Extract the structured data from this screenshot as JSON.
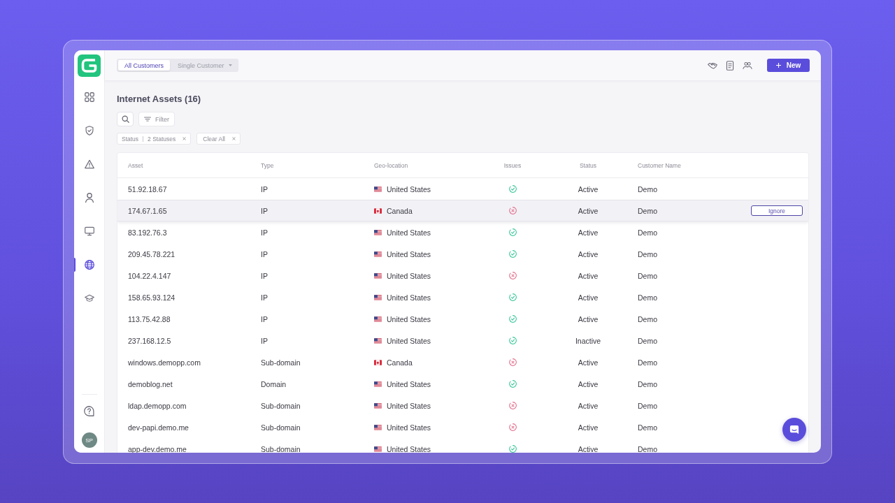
{
  "sidebar": {
    "items": [
      {
        "selected": false
      },
      {
        "selected": false
      },
      {
        "selected": false
      },
      {
        "selected": false
      },
      {
        "selected": false
      },
      {
        "selected": true
      },
      {
        "selected": false
      }
    ],
    "avatar": {
      "initials": "SP"
    }
  },
  "top_bar": {
    "scope_tabs": [
      {
        "label": "All Customers",
        "selected": true,
        "dropdown": false
      },
      {
        "label": "Single Customer",
        "selected": false,
        "dropdown": true
      }
    ],
    "new_button": {
      "label": "New"
    }
  },
  "page": {
    "title": "Internet Assets (16)",
    "filter_button": {
      "label": "Filter"
    },
    "chips": [
      {
        "kind": "filter",
        "label": "Status",
        "value": "2 Statuses"
      },
      {
        "kind": "clear",
        "label": "Clear All"
      }
    ]
  },
  "table": {
    "columns": [
      "Asset",
      "Type",
      "Geo-location",
      "Issues",
      "Status",
      "Customer Name"
    ],
    "rows": [
      {
        "asset": "51.92.18.67",
        "type": "IP",
        "geo": {
          "kind": "us",
          "country": "United States"
        },
        "issues_found": false,
        "status": "Active",
        "customer": "Demo",
        "highlighted": false
      },
      {
        "asset": "174.67.1.65",
        "type": "IP",
        "geo": {
          "kind": "ca",
          "country": "Canada"
        },
        "issues_found": true,
        "status": "Active",
        "customer": "Demo",
        "highlighted": true,
        "action": "Ignore"
      },
      {
        "asset": "83.192.76.3",
        "type": "IP",
        "geo": {
          "kind": "us",
          "country": "United States"
        },
        "issues_found": false,
        "status": "Active",
        "customer": "Demo",
        "highlighted": false
      },
      {
        "asset": "209.45.78.221",
        "type": "IP",
        "geo": {
          "kind": "us",
          "country": "United States"
        },
        "issues_found": false,
        "status": "Active",
        "customer": "Demo",
        "highlighted": false
      },
      {
        "asset": "104.22.4.147",
        "type": "IP",
        "geo": {
          "kind": "us",
          "country": "United States"
        },
        "issues_found": true,
        "status": "Active",
        "customer": "Demo",
        "highlighted": false
      },
      {
        "asset": "158.65.93.124",
        "type": "IP",
        "geo": {
          "kind": "us",
          "country": "United States"
        },
        "issues_found": false,
        "status": "Active",
        "customer": "Demo",
        "highlighted": false
      },
      {
        "asset": "113.75.42.88",
        "type": "IP",
        "geo": {
          "kind": "us",
          "country": "United States"
        },
        "issues_found": false,
        "status": "Active",
        "customer": "Demo",
        "highlighted": false
      },
      {
        "asset": "237.168.12.5",
        "type": "IP",
        "geo": {
          "kind": "us",
          "country": "United States"
        },
        "issues_found": false,
        "status": "Inactive",
        "customer": "Demo",
        "highlighted": false
      },
      {
        "asset": "windows.demopp.com",
        "type": "Sub-domain",
        "geo": {
          "kind": "ca",
          "country": "Canada"
        },
        "issues_found": true,
        "status": "Active",
        "customer": "Demo",
        "highlighted": false
      },
      {
        "asset": "demoblog.net",
        "type": "Domain",
        "geo": {
          "kind": "us",
          "country": "United States"
        },
        "issues_found": false,
        "status": "Active",
        "customer": "Demo",
        "highlighted": false
      },
      {
        "asset": "ldap.demopp.com",
        "type": "Sub-domain",
        "geo": {
          "kind": "us",
          "country": "United States"
        },
        "issues_found": true,
        "status": "Active",
        "customer": "Demo",
        "highlighted": false
      },
      {
        "asset": "dev-papi.demo.me",
        "type": "Sub-domain",
        "geo": {
          "kind": "us",
          "country": "United States"
        },
        "issues_found": true,
        "status": "Active",
        "customer": "Demo",
        "highlighted": false
      },
      {
        "asset": "app-dev.demo.me",
        "type": "Sub-domain",
        "geo": {
          "kind": "us",
          "country": "United States"
        },
        "issues_found": false,
        "status": "Active",
        "customer": "Demo",
        "highlighted": false
      }
    ]
  }
}
